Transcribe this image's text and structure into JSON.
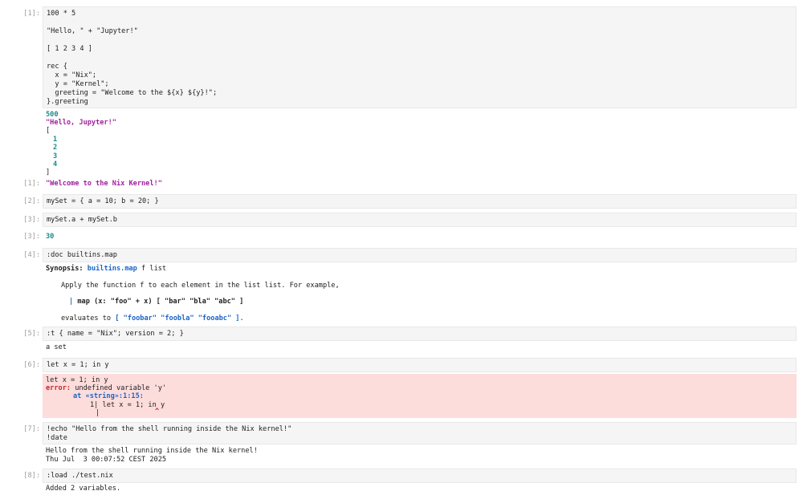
{
  "cells": {
    "c1": {
      "prompt": "[1]:",
      "input": [
        "100 * 5",
        "",
        "\"Hello, \" + \"Jupyter!\"",
        "",
        "[ 1 2 3 4 ]",
        "",
        "rec {",
        "  x = \"Nix\";",
        "  y = \"Kernel\";",
        "  greeting = \"Welcome to the ${x} ${y}!\";",
        "}.greeting"
      ],
      "output_num": "500",
      "output_str": "\"Hello, Jupyter!\"",
      "list_open": "[",
      "list_items": [
        "1",
        "2",
        "3",
        "4"
      ],
      "list_close": "]",
      "result_prompt": "[1]:",
      "result": "\"Welcome to the Nix Kernel!\""
    },
    "c2": {
      "prompt": "[2]:",
      "input": "mySet = { a = 10; b = 20; }"
    },
    "c3": {
      "prompt": "[3]:",
      "input": "mySet.a + mySet.b",
      "result_prompt": "[3]:",
      "result": "30"
    },
    "c4": {
      "prompt": "[4]:",
      "input": ":doc builtins.map",
      "synopsis_label": "Synopsis:",
      "synopsis_fn": "builtins.map",
      "synopsis_args": "f list",
      "desc": "Apply the function f to each element in the list list. For example,",
      "example_bar": "|",
      "example": "map (x: \"foo\" + x) [ \"bar\" \"bla\" \"abc\" ]",
      "evaluates_prefix": "evaluates to ",
      "evaluates_value": "[ \"foobar\" \"foobla\" \"fooabc\" ]",
      "evaluates_suffix": "."
    },
    "c5": {
      "prompt": "[5]:",
      "input": ":t { name = \"Nix\"; version = 2; }",
      "output": "a set"
    },
    "c6": {
      "prompt": "[6]:",
      "input": "let x = 1; in y",
      "err_echo": "let x = 1; in y",
      "err_label": "error:",
      "err_msg": " undefined variable 'y'",
      "err_at": "at «string»:1:15:",
      "err_line": "1| let x = 1; in y",
      "err_bar": "|",
      "err_caret": "^"
    },
    "c7": {
      "prompt": "[7]:",
      "input": [
        "!echo \"Hello from the shell running inside the Nix kernel!\"",
        "!date"
      ],
      "output": [
        "Hello from the shell running inside the Nix kernel!",
        "Thu Jul  3 00:07:52 CEST 2025"
      ]
    },
    "c8": {
      "prompt": "[8]:",
      "input": ":load ./test.nix",
      "output": "Added 2 variables."
    }
  }
}
